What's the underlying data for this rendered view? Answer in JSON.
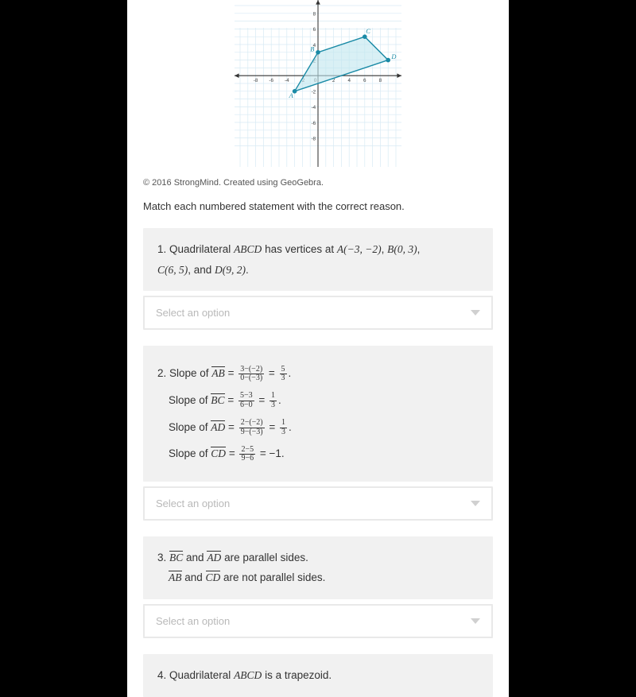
{
  "copyright": "© 2016 StrongMind. Created using GeoGebra.",
  "instruction": "Match each numbered statement with the correct reason.",
  "select_placeholder": "Select an option",
  "statements": {
    "s1_prefix": "1. Quadrilateral ",
    "s1_abcd": "ABCD",
    "s1_mid": " has vertices at ",
    "s1_a": "A(−3, −2)",
    "s1_b": "B(0, 3)",
    "s1_c": "C(6, 5)",
    "s1_d": "D(9, 2)",
    "s2_prefix": "2. Slope of ",
    "seg_ab": "AB",
    "seg_bc": "BC",
    "seg_ad": "AD",
    "seg_cd": "CD",
    "slope_ab_num": "3−(−2)",
    "slope_ab_den": "0−(−3)",
    "slope_ab_r_num": "5",
    "slope_ab_r_den": "3",
    "slope_bc_num": "5−3",
    "slope_bc_den": "6−0",
    "slope_bc_r_num": "1",
    "slope_bc_r_den": "3",
    "slope_ad_num": "2−(−2)",
    "slope_ad_den": "9−(−3)",
    "slope_ad_r_num": "1",
    "slope_ad_r_den": "3",
    "slope_cd_num": "2−5",
    "slope_cd_den": "9−6",
    "slope_cd_r": "−1",
    "slope_of": "Slope of ",
    "s3_prefix": "3. ",
    "s3_parallel": " are parallel sides.",
    "s3_not_parallel": " are not parallel sides.",
    "and": " and ",
    "s4_prefix": "4. Quadrilateral ",
    "s4_abcd": "ABCD",
    "s4_suffix": " is a trapezoid."
  },
  "chart_data": {
    "type": "scatter",
    "title": "",
    "x_ticks": [
      -8,
      -6,
      -4,
      -2,
      0,
      2,
      4,
      6,
      8
    ],
    "y_ticks": [
      -8,
      -6,
      -4,
      -2,
      0,
      2,
      4,
      6,
      8
    ],
    "points": {
      "A": {
        "x": -3,
        "y": -2
      },
      "B": {
        "x": 0,
        "y": 3
      },
      "C": {
        "x": 6,
        "y": 5
      },
      "D": {
        "x": 9,
        "y": 2
      }
    },
    "polygon": [
      "A",
      "B",
      "C",
      "D"
    ],
    "xlabel": "",
    "ylabel": "",
    "xlim": [
      -9,
      9
    ],
    "ylim": [
      -9,
      9
    ]
  }
}
